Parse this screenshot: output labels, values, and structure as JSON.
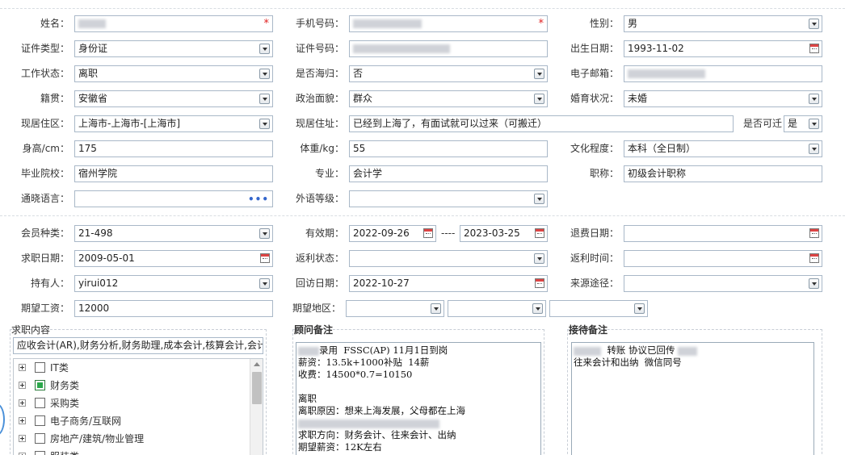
{
  "basic": {
    "name": {
      "label": "姓名：",
      "value": "",
      "required_mark": "*"
    },
    "phone": {
      "label": "手机号码：",
      "value": "",
      "required_mark": "*"
    },
    "gender": {
      "label": "性别：",
      "value": "男"
    },
    "id_type": {
      "label": "证件类型：",
      "value": "身份证"
    },
    "id_number": {
      "label": "证件号码：",
      "value": ""
    },
    "birth_date": {
      "label": "出生日期：",
      "value": "1993-11-02"
    },
    "work_status": {
      "label": "工作状态：",
      "value": "离职"
    },
    "overseas": {
      "label": "是否海归：",
      "value": "否"
    },
    "email": {
      "label": "电子邮箱：",
      "value": ""
    },
    "native_place": {
      "label": "籍贯：",
      "value": "安徽省"
    },
    "political_status": {
      "label": "政治面貌：",
      "value": "群众"
    },
    "marital_status": {
      "label": "婚育状况：",
      "value": "未婚"
    },
    "current_area": {
      "label": "现居住区：",
      "value": "上海市-上海市-[上海市]"
    },
    "current_address": {
      "label": "现居住址：",
      "value": "已经到上海了，有面试就可以过来（可搬迁）"
    },
    "relocate": {
      "label": "是否可迁",
      "value": "是"
    },
    "height": {
      "label": "身高/cm：",
      "value": "175"
    },
    "weight": {
      "label": "体重/kg：",
      "value": "55"
    },
    "education": {
      "label": "文化程度：",
      "value": "本科（全日制）"
    },
    "school": {
      "label": "毕业院校：",
      "value": "宿州学院"
    },
    "major": {
      "label": "专业：",
      "value": "会计学"
    },
    "title": {
      "label": "职称：",
      "value": "初级会计职称"
    },
    "languages": {
      "label": "通晓语言：",
      "value": "",
      "more": "•••"
    },
    "foreign_level": {
      "label": "外语等级：",
      "value": ""
    }
  },
  "member": {
    "member_type": {
      "label": "会员种类：",
      "value": "21-498"
    },
    "valid_period": {
      "label": "有效期：",
      "from": "2022-09-26",
      "sep": "----",
      "to": "2023-03-25"
    },
    "refund_date": {
      "label": "退费日期：",
      "value": ""
    },
    "job_date": {
      "label": "求职日期：",
      "value": "2009-05-01"
    },
    "rebate_status": {
      "label": "返利状态：",
      "value": ""
    },
    "rebate_time": {
      "label": "返利时间：",
      "value": ""
    },
    "holder": {
      "label": "持有人：",
      "value": "yirui012"
    },
    "visit_date": {
      "label": "回访日期：",
      "value": "2022-10-27"
    },
    "source": {
      "label": "来源途径：",
      "value": ""
    },
    "salary": {
      "label": "期望工资：",
      "value": "12000"
    },
    "region": {
      "label": "期望地区：",
      "values": [
        "",
        "",
        ""
      ]
    }
  },
  "job_content": {
    "title": "求职内容",
    "summary": "应收会计(AR),财务分析,财务助理,成本会计,核算会计,会计",
    "tree": [
      {
        "label": "IT类",
        "checked": false
      },
      {
        "label": "财务类",
        "checked": true
      },
      {
        "label": "采购类",
        "checked": false
      },
      {
        "label": "电子商务/互联网",
        "checked": false
      },
      {
        "label": "房地产/建筑/物业管理",
        "checked": false
      },
      {
        "label": "服装类",
        "checked": false
      }
    ]
  },
  "advisor_notes": {
    "title": "顾问备注",
    "lines": [
      "录用  FSSC(AP) 11月1日到岗",
      "薪资：13.5k+1000补贴  14薪",
      "收费：14500*0.7=10150",
      "",
      "离职",
      "离职原因：想来上海发展，父母都在上海",
      "",
      "求职方向：财务会计、往来会计、出纳",
      "期望薪资：12K左右"
    ]
  },
  "reception_notes": {
    "title": "接待备注",
    "lines": [
      "转账 协议已回传",
      "往来会计和出纳  微信同号"
    ]
  }
}
